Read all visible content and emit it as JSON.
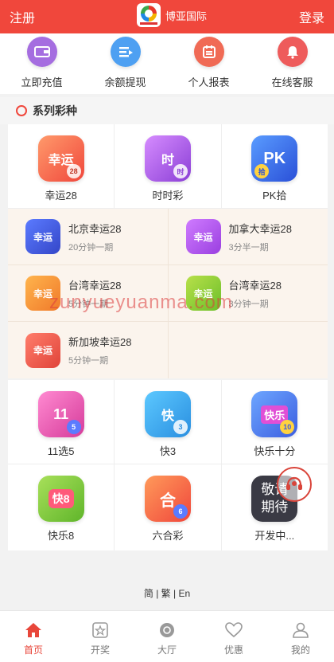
{
  "header": {
    "left_label": "注册",
    "brand_name": "博亚国际",
    "right_label": "登录"
  },
  "quick_actions": [
    {
      "label": "立即充值",
      "icon": "wallet-icon"
    },
    {
      "label": "余额提现",
      "icon": "withdraw-icon"
    },
    {
      "label": "个人报表",
      "icon": "calendar-icon"
    },
    {
      "label": "在线客服",
      "icon": "bell-icon"
    }
  ],
  "section": {
    "title": "系列彩种"
  },
  "row1": [
    {
      "label": "幸运28",
      "icon_text": "幸运",
      "badge": "28"
    },
    {
      "label": "时时彩",
      "icon_text": "时",
      "badge": "时"
    },
    {
      "label": "PK拾",
      "icon_text": "PK",
      "badge": "拾"
    }
  ],
  "sub_items": [
    {
      "name": "北京幸运28",
      "desc": "20分钟一期",
      "icon_text": "幸运"
    },
    {
      "name": "加拿大幸运28",
      "desc": "3分半一期",
      "icon_text": "幸运"
    },
    {
      "name": "台湾幸运28",
      "desc": "5分钟一期",
      "icon_text": "幸运"
    },
    {
      "name": "台湾幸运28",
      "desc": "3分钟一期",
      "icon_text": "幸运"
    },
    {
      "name": "新加坡幸运28",
      "desc": "5分钟一期",
      "icon_text": "幸运"
    }
  ],
  "row2": [
    {
      "label": "11选5",
      "icon_text": "11",
      "badge": "5"
    },
    {
      "label": "快3",
      "icon_text": "快",
      "badge": "3"
    },
    {
      "label": "快乐十分",
      "icon_text": "快乐",
      "badge": "10"
    }
  ],
  "row3": [
    {
      "label": "快乐8",
      "icon_text": "快8"
    },
    {
      "label": "六合彩",
      "icon_text": "合",
      "badge": "6"
    },
    {
      "label": "开发中...",
      "icon_text_1": "敬请",
      "icon_text_2": "期待"
    }
  ],
  "watermark": "zunyueyuanma.com",
  "language_switch": "简 | 繁 | En",
  "tabs": [
    {
      "label": "首页",
      "icon": "home-icon",
      "active": true
    },
    {
      "label": "开奖",
      "icon": "lottery-icon"
    },
    {
      "label": "大厅",
      "icon": "hall-icon"
    },
    {
      "label": "优惠",
      "icon": "heart-icon"
    },
    {
      "label": "我的",
      "icon": "user-icon"
    }
  ],
  "colors": {
    "brand": "#f0473c",
    "active_tab": "#e8463a"
  }
}
